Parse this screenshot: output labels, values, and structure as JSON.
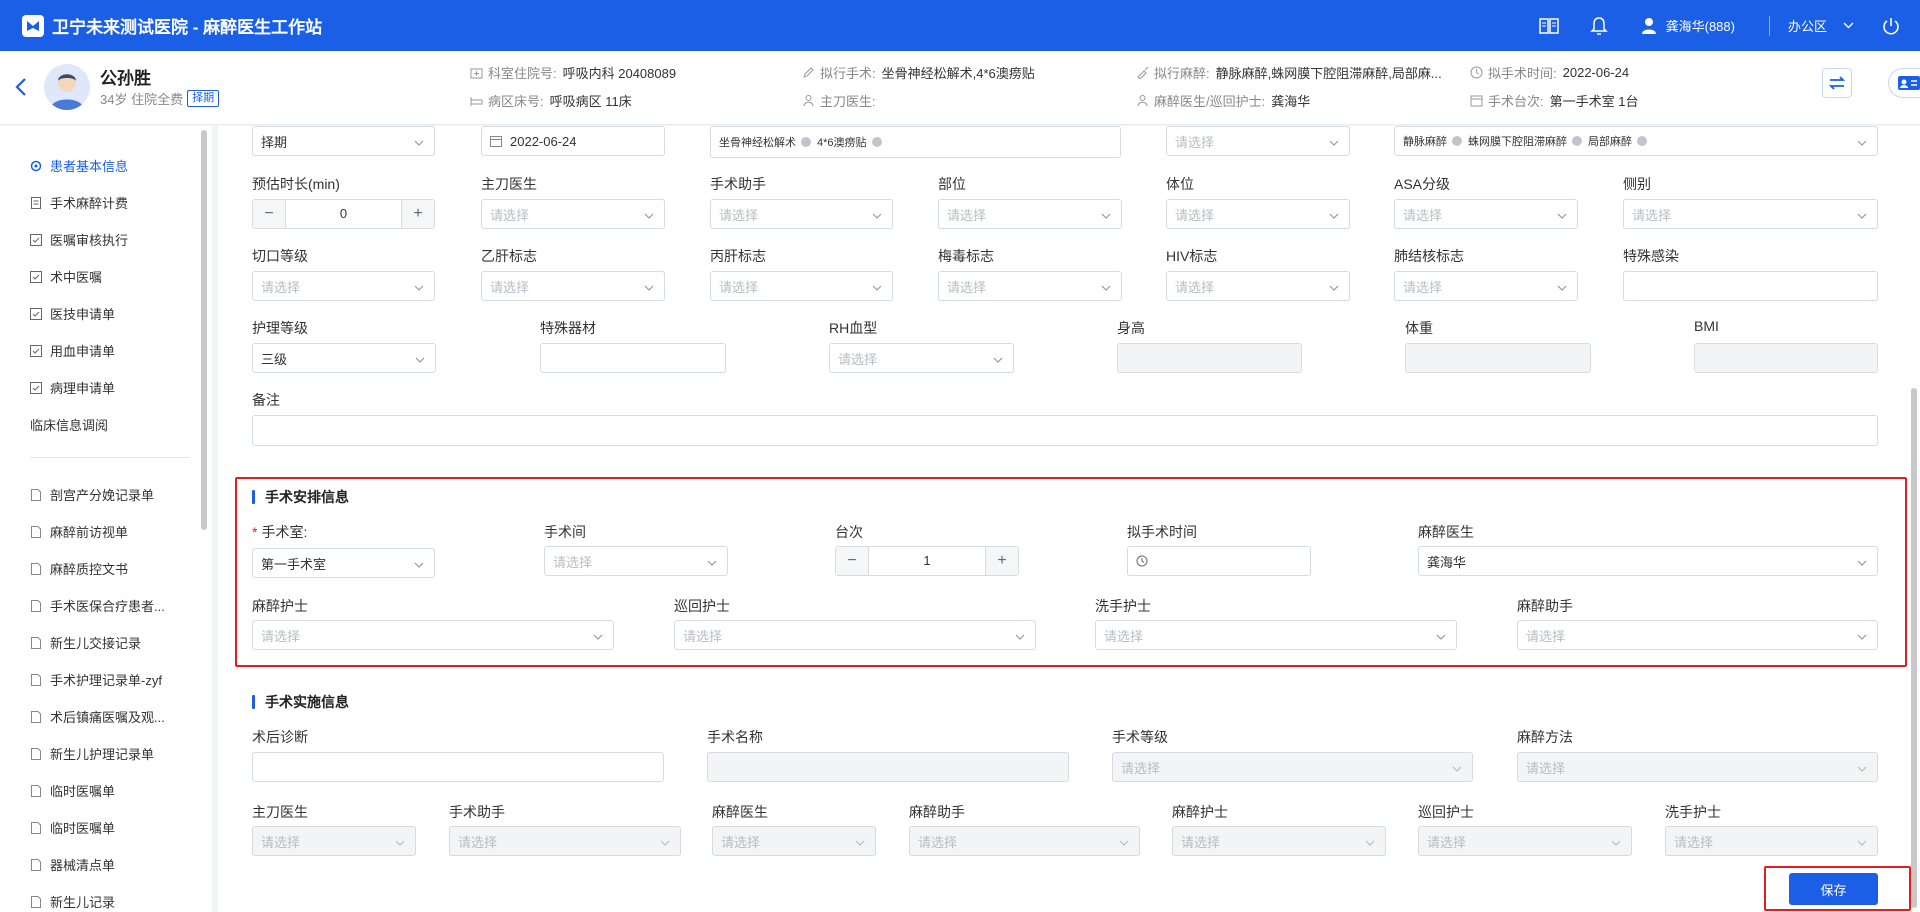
{
  "app": {
    "title": "卫宁未来测试医院 - 麻醉医生工作站",
    "user": "龚海华(888)",
    "office": "办公区"
  },
  "patient": {
    "name": "公孙胜",
    "info": "34岁 住院全费",
    "badge": "择期",
    "dept_label": "科室住院号:",
    "dept_value": "呼吸内科 20408089",
    "ward_label": "病区床号:",
    "ward_value": "呼吸病区 11床",
    "surgery_label": "拟行手术:",
    "surgery_value": "坐骨神经松解术,4*6澳痨贴",
    "surgeon_label": "主刀医生:",
    "surgeon_value": "",
    "anes_label": "拟行麻醉:",
    "anes_value": "静脉麻醉,蛛网膜下腔阻滞麻醉,局部麻...",
    "anes_doc_label": "麻醉医生/巡回护士:",
    "anes_doc_value": "龚海华",
    "time_label": "拟手术时间:",
    "time_value": "2022-06-24",
    "room_label": "手术台次:",
    "room_value": "第一手术室 1台"
  },
  "sidebar": {
    "items": [
      "患者基本信息",
      "手术麻醉计费",
      "医嘱审核执行",
      "术中医嘱",
      "医技申请单",
      "用血申请单",
      "病理申请单"
    ],
    "plain": "临床信息调阅",
    "docs": [
      "剖宫产分娩记录单",
      "麻醉前访视单",
      "麻醉质控文书",
      "手术医保合疗患者...",
      "新生儿交接记录",
      "手术护理记录单-zyf",
      "术后镇痛医嘱及观...",
      "新生儿护理记录单",
      "临时医嘱单",
      "临时医嘱单",
      "器械清点单",
      "新生儿记录"
    ]
  },
  "form": {
    "placeholder": "请选择",
    "top": {
      "type": "择期",
      "date": "2022-06-24",
      "surgery_tags": [
        "坐骨神经松解术",
        "4*6澳痨贴"
      ],
      "anes_tags": [
        "静脉麻醉",
        "蛛网膜下腔阻滞麻醉",
        "局部麻醉"
      ]
    },
    "labels1": [
      "预估时长(min)",
      "主刀医生",
      "手术助手",
      "部位",
      "体位",
      "ASA分级",
      "侧别"
    ],
    "duration": "0",
    "labels2": [
      "切口等级",
      "乙肝标志",
      "丙肝标志",
      "梅毒标志",
      "HIV标志",
      "肺结核标志",
      "特殊感染"
    ],
    "labels3": [
      "护理等级",
      "特殊器材",
      "RH血型",
      "身高",
      "体重",
      "BMI"
    ],
    "care_level": "三级",
    "remark_label": "备注"
  },
  "arrange": {
    "title": "手术安排信息",
    "room_label": "手术室:",
    "room_value": "第一手术室",
    "theater_label": "手术间",
    "seq_label": "台次",
    "seq_value": "1",
    "time_label": "拟手术时间",
    "anes_doc_label": "麻醉医生",
    "anes_doc_value": "龚海华",
    "anes_nurse_label": "麻醉护士",
    "circ_nurse_label": "巡回护士",
    "scrub_nurse_label": "洗手护士",
    "anes_assist_label": "麻醉助手"
  },
  "impl": {
    "title": "手术实施信息",
    "labels1": [
      "术后诊断",
      "手术名称",
      "手术等级",
      "麻醉方法"
    ],
    "labels2": [
      "主刀医生",
      "手术助手",
      "麻醉医生",
      "麻醉助手",
      "麻醉护士",
      "巡回护士",
      "洗手护士"
    ]
  },
  "save_label": "保存"
}
